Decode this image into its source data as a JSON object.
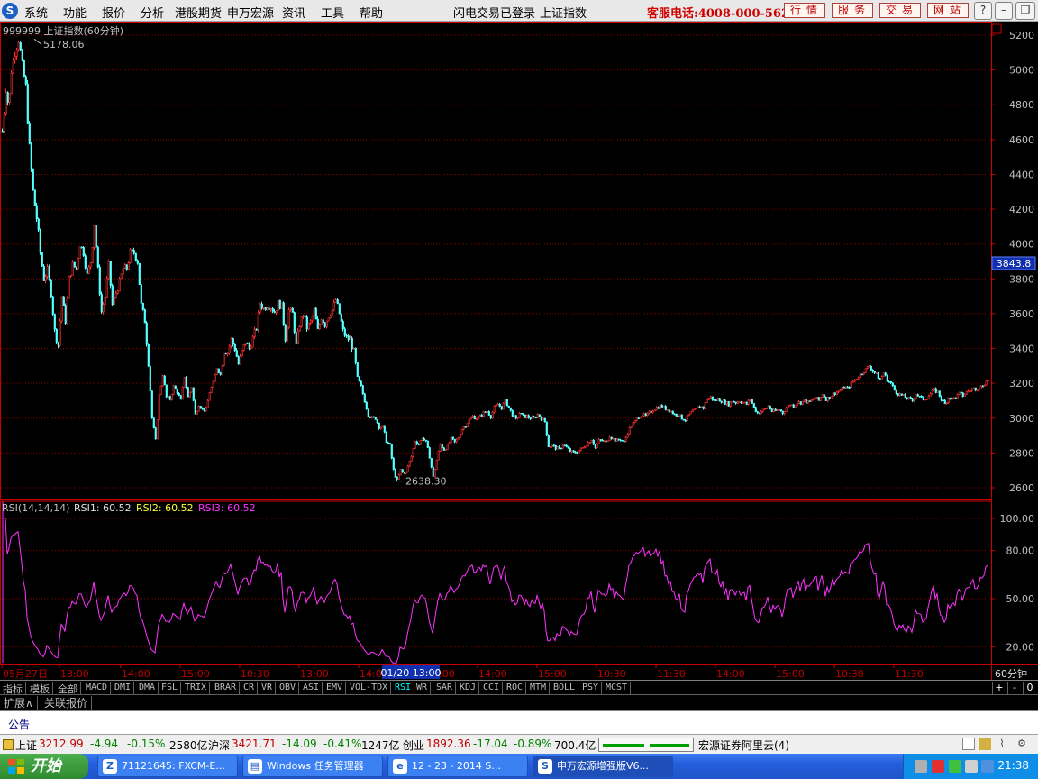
{
  "menubar": {
    "logo": "S",
    "items": [
      "系统",
      "功能",
      "报价",
      "分析",
      "港股期货",
      "申万宏源",
      "资讯",
      "工具",
      "帮助"
    ],
    "status": "闪电交易已登录",
    "current_index": "上证指数",
    "hotline": "客服电话:4008-000-562",
    "buttons": [
      "行情",
      "服务",
      "交易",
      "网站"
    ],
    "window_controls": [
      "?",
      "–",
      "❐",
      "✕"
    ]
  },
  "main_chart": {
    "title": "999999 上证指数(60分钟)",
    "high_label": "5178.06",
    "low_label": "2638.30",
    "current_price_tag": "3843.8",
    "y_ticks": [
      "5200",
      "5000",
      "4800",
      "4600",
      "4400",
      "4200",
      "4000",
      "3800",
      "3600",
      "3400",
      "3200",
      "3000",
      "2800",
      "2600"
    ]
  },
  "rsi_panel": {
    "params": "RSI(14,14,14)",
    "rsi1": "RSI1: 60.52",
    "rsi2": "RSI2: 60.52",
    "rsi3": "RSI3: 60.52",
    "y_ticks": [
      "100.00",
      "80.00",
      "50.00",
      "20.00"
    ]
  },
  "time_axis": {
    "labels": [
      "05月27日",
      "13:00",
      "14:00",
      "15:00",
      "10:30",
      "13:00",
      "14:00",
      "13:00",
      "14:00",
      "15:00",
      "10:30",
      "11:30",
      "14:00",
      "15:00",
      "10:30",
      "11:30"
    ],
    "cursor_date": "01/20 13:00",
    "period": "60分钟"
  },
  "indicator_tabs": [
    "指标",
    "模板",
    "全部",
    "MACD",
    "DMI",
    "DMA",
    "FSL",
    "TRIX",
    "BRAR",
    "CR",
    "VR",
    "OBV",
    "ASI",
    "EMV",
    "VOL-TDX",
    "RSI",
    "WR",
    "SAR",
    "KDJ",
    "CCI",
    "ROC",
    "MTM",
    "BOLL",
    "PSY",
    "MCST"
  ],
  "indicator_active": "RSI",
  "indicator_controls": [
    "+",
    "-",
    "0"
  ],
  "extension_tabs": [
    "扩展∧",
    "关联报价"
  ],
  "notice_label": "公告",
  "statusbar": {
    "sh_name": "上证",
    "sh_value": "3212.99",
    "sh_change": "-4.94",
    "sh_pct": "-0.15%",
    "sh_amount": "2580亿",
    "hs_name": "沪深",
    "hs_value": "3421.71",
    "hs_change": "-14.09",
    "hs_pct": "-0.41%",
    "hs_amount": "1247亿",
    "cy_name": "创业",
    "cy_value": "1892.36",
    "cy_change": "-17.04",
    "cy_pct": "-0.89%",
    "cy_amount": "700.4亿",
    "server": "宏源证券阿里云(4)"
  },
  "taskbar": {
    "start": "开始",
    "tasks": [
      "71121645: FXCM-E...",
      "Windows 任务管理器",
      "12 - 23 - 2014 S...",
      "申万宏源增强版V6..."
    ],
    "clock": "21:38"
  },
  "colors": {
    "up": "#ff3232",
    "down": "#54ffff",
    "rsi": "#ff33ff",
    "grid": "#8b0000",
    "axis": "#c80000"
  },
  "chart_data": {
    "type": "candlestick",
    "title": "999999 上证指数(60分钟)",
    "anchor_points": [
      [
        0,
        4550
      ],
      [
        3,
        4700
      ],
      [
        6,
        4900
      ],
      [
        9,
        4780
      ],
      [
        12,
        5000
      ],
      [
        16,
        5110
      ],
      [
        20,
        5178
      ],
      [
        24,
        5020
      ],
      [
        28,
        4900
      ],
      [
        32,
        4550
      ],
      [
        36,
        4300
      ],
      [
        40,
        4150
      ],
      [
        44,
        3950
      ],
      [
        48,
        3800
      ],
      [
        52,
        3850
      ],
      [
        56,
        3720
      ],
      [
        60,
        3500
      ],
      [
        64,
        3420
      ],
      [
        68,
        3700
      ],
      [
        72,
        3560
      ],
      [
        76,
        3800
      ],
      [
        80,
        3880
      ],
      [
        84,
        3860
      ],
      [
        88,
        4000
      ],
      [
        92,
        3950
      ],
      [
        96,
        3820
      ],
      [
        100,
        3900
      ],
      [
        104,
        4120
      ],
      [
        108,
        3850
      ],
      [
        112,
        3610
      ],
      [
        116,
        3700
      ],
      [
        120,
        3880
      ],
      [
        124,
        3650
      ],
      [
        128,
        3720
      ],
      [
        132,
        3780
      ],
      [
        136,
        3860
      ],
      [
        140,
        3860
      ],
      [
        144,
        3950
      ],
      [
        148,
        3950
      ],
      [
        152,
        3900
      ],
      [
        156,
        3650
      ],
      [
        160,
        3560
      ],
      [
        164,
        3320
      ],
      [
        168,
        3000
      ],
      [
        172,
        2870
      ],
      [
        176,
        3130
      ],
      [
        180,
        3250
      ],
      [
        184,
        3120
      ],
      [
        188,
        3110
      ],
      [
        192,
        3180
      ],
      [
        196,
        3150
      ],
      [
        200,
        3100
      ],
      [
        204,
        3240
      ],
      [
        208,
        3120
      ],
      [
        212,
        3180
      ],
      [
        216,
        3020
      ],
      [
        220,
        3080
      ],
      [
        224,
        3050
      ],
      [
        228,
        3050
      ],
      [
        232,
        3150
      ],
      [
        236,
        3200
      ],
      [
        240,
        3290
      ],
      [
        244,
        3250
      ],
      [
        248,
        3390
      ],
      [
        252,
        3380
      ],
      [
        256,
        3450
      ],
      [
        260,
        3400
      ],
      [
        264,
        3310
      ],
      [
        268,
        3380
      ],
      [
        272,
        3440
      ],
      [
        276,
        3400
      ],
      [
        280,
        3460
      ],
      [
        284,
        3520
      ],
      [
        288,
        3660
      ],
      [
        292,
        3630
      ],
      [
        296,
        3650
      ],
      [
        300,
        3640
      ],
      [
        304,
        3610
      ],
      [
        308,
        3660
      ],
      [
        312,
        3640
      ],
      [
        316,
        3460
      ],
      [
        320,
        3620
      ],
      [
        324,
        3600
      ],
      [
        328,
        3420
      ],
      [
        332,
        3540
      ],
      [
        336,
        3600
      ],
      [
        340,
        3520
      ],
      [
        344,
        3550
      ],
      [
        348,
        3620
      ],
      [
        352,
        3500
      ],
      [
        356,
        3580
      ],
      [
        360,
        3540
      ],
      [
        364,
        3590
      ],
      [
        368,
        3620
      ],
      [
        372,
        3680
      ],
      [
        376,
        3600
      ],
      [
        380,
        3500
      ],
      [
        384,
        3460
      ],
      [
        388,
        3450
      ],
      [
        392,
        3380
      ],
      [
        396,
        3230
      ],
      [
        400,
        3180
      ],
      [
        404,
        3100
      ],
      [
        408,
        3020
      ],
      [
        412,
        3000
      ],
      [
        416,
        3000
      ],
      [
        420,
        2950
      ],
      [
        424,
        2950
      ],
      [
        428,
        2870
      ],
      [
        432,
        2840
      ],
      [
        436,
        2700
      ],
      [
        440,
        2640
      ],
      [
        444,
        2700
      ],
      [
        448,
        2680
      ],
      [
        452,
        2720
      ],
      [
        456,
        2780
      ],
      [
        460,
        2870
      ],
      [
        464,
        2850
      ],
      [
        468,
        2890
      ],
      [
        472,
        2860
      ],
      [
        476,
        2780
      ],
      [
        480,
        2660
      ],
      [
        484,
        2760
      ],
      [
        488,
        2850
      ],
      [
        492,
        2820
      ],
      [
        496,
        2840
      ],
      [
        500,
        2880
      ],
      [
        504,
        2860
      ],
      [
        508,
        2890
      ],
      [
        512,
        2940
      ],
      [
        516,
        2960
      ],
      [
        520,
        2990
      ],
      [
        524,
        3010
      ],
      [
        528,
        3000
      ],
      [
        532,
        3010
      ],
      [
        536,
        3030
      ],
      [
        540,
        3040
      ],
      [
        544,
        3010
      ],
      [
        548,
        3060
      ],
      [
        552,
        3080
      ],
      [
        556,
        3060
      ],
      [
        560,
        3100
      ],
      [
        564,
        3060
      ],
      [
        568,
        3020
      ],
      [
        572,
        2990
      ],
      [
        576,
        3030
      ],
      [
        580,
        3010
      ],
      [
        584,
        3010
      ],
      [
        588,
        3000
      ],
      [
        592,
        3000
      ],
      [
        596,
        3020
      ],
      [
        600,
        3000
      ],
      [
        604,
        2980
      ],
      [
        608,
        2840
      ],
      [
        612,
        2840
      ],
      [
        616,
        2830
      ],
      [
        620,
        2820
      ],
      [
        624,
        2850
      ],
      [
        628,
        2830
      ],
      [
        632,
        2810
      ],
      [
        636,
        2800
      ],
      [
        640,
        2810
      ],
      [
        644,
        2820
      ],
      [
        648,
        2840
      ],
      [
        652,
        2860
      ],
      [
        656,
        2880
      ],
      [
        660,
        2830
      ],
      [
        664,
        2870
      ],
      [
        668,
        2870
      ],
      [
        672,
        2860
      ],
      [
        676,
        2900
      ],
      [
        680,
        2880
      ],
      [
        684,
        2870
      ],
      [
        688,
        2880
      ],
      [
        692,
        2860
      ],
      [
        696,
        2920
      ],
      [
        700,
        2960
      ],
      [
        704,
        2980
      ],
      [
        708,
        3010
      ],
      [
        712,
        3020
      ],
      [
        716,
        3010
      ],
      [
        720,
        3030
      ],
      [
        724,
        3050
      ],
      [
        728,
        3060
      ],
      [
        732,
        3070
      ],
      [
        736,
        3060
      ],
      [
        740,
        3050
      ],
      [
        744,
        3040
      ],
      [
        748,
        3020
      ],
      [
        752,
        3020
      ],
      [
        756,
        3000
      ],
      [
        760,
        2990
      ],
      [
        764,
        3020
      ],
      [
        768,
        3040
      ],
      [
        772,
        3050
      ],
      [
        776,
        3070
      ],
      [
        780,
        3060
      ],
      [
        784,
        3110
      ],
      [
        788,
        3120
      ],
      [
        792,
        3100
      ],
      [
        796,
        3110
      ],
      [
        800,
        3100
      ],
      [
        804,
        3090
      ],
      [
        808,
        3080
      ],
      [
        812,
        3100
      ],
      [
        816,
        3090
      ],
      [
        820,
        3100
      ],
      [
        824,
        3090
      ],
      [
        828,
        3080
      ],
      [
        832,
        3110
      ],
      [
        836,
        3060
      ],
      [
        840,
        3030
      ],
      [
        844,
        3040
      ],
      [
        848,
        3050
      ],
      [
        852,
        3070
      ],
      [
        856,
        3040
      ],
      [
        860,
        3040
      ],
      [
        864,
        3050
      ],
      [
        868,
        3030
      ],
      [
        872,
        3060
      ],
      [
        876,
        3080
      ],
      [
        880,
        3070
      ],
      [
        884,
        3090
      ],
      [
        888,
        3090
      ],
      [
        892,
        3100
      ],
      [
        896,
        3090
      ],
      [
        900,
        3100
      ],
      [
        904,
        3120
      ],
      [
        908,
        3100
      ],
      [
        912,
        3140
      ],
      [
        916,
        3110
      ],
      [
        920,
        3120
      ],
      [
        924,
        3140
      ],
      [
        928,
        3150
      ],
      [
        932,
        3160
      ],
      [
        936,
        3180
      ],
      [
        940,
        3170
      ],
      [
        944,
        3200
      ],
      [
        948,
        3220
      ],
      [
        952,
        3240
      ],
      [
        956,
        3260
      ],
      [
        960,
        3280
      ],
      [
        964,
        3300
      ],
      [
        968,
        3270
      ],
      [
        972,
        3250
      ],
      [
        976,
        3220
      ],
      [
        980,
        3260
      ],
      [
        984,
        3220
      ],
      [
        988,
        3200
      ],
      [
        992,
        3160
      ],
      [
        996,
        3140
      ],
      [
        1000,
        3130
      ],
      [
        1004,
        3120
      ],
      [
        1008,
        3110
      ],
      [
        1012,
        3100
      ],
      [
        1016,
        3140
      ],
      [
        1020,
        3120
      ],
      [
        1024,
        3110
      ],
      [
        1028,
        3120
      ],
      [
        1032,
        3140
      ],
      [
        1036,
        3160
      ],
      [
        1040,
        3150
      ],
      [
        1044,
        3110
      ],
      [
        1048,
        3080
      ],
      [
        1052,
        3120
      ],
      [
        1056,
        3110
      ],
      [
        1060,
        3120
      ],
      [
        1064,
        3140
      ],
      [
        1068,
        3130
      ],
      [
        1072,
        3150
      ],
      [
        1076,
        3160
      ],
      [
        1080,
        3170
      ],
      [
        1084,
        3170
      ],
      [
        1088,
        3180
      ],
      [
        1092,
        3200
      ],
      [
        1096,
        3220
      ],
      [
        1099,
        3220
      ]
    ],
    "y_range": [
      2600,
      5200
    ],
    "extremes": {
      "high": 5178.06,
      "low": 2638.3
    },
    "rsi_y_range": [
      10,
      100
    ]
  }
}
